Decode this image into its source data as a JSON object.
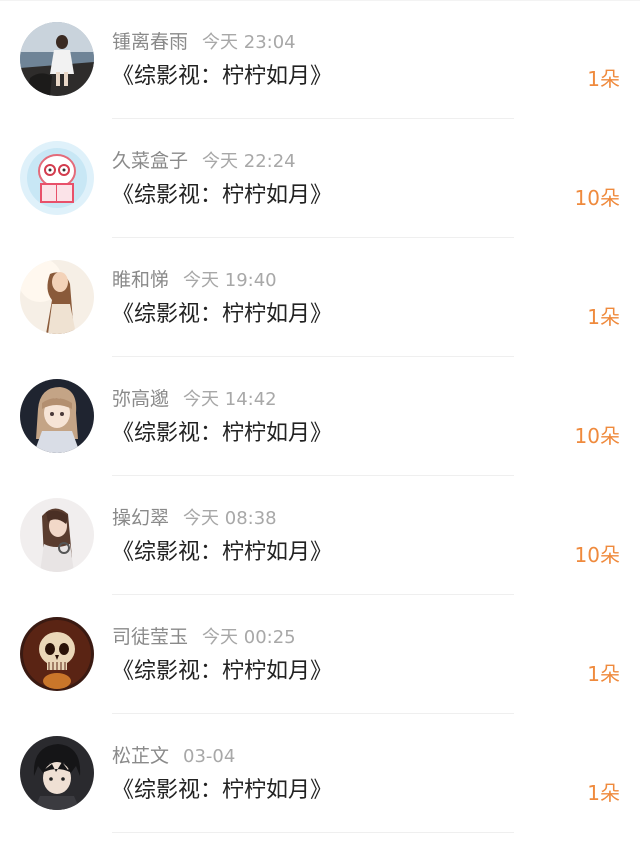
{
  "colors": {
    "amount": "#ef8a3d",
    "name": "#8a8a8a",
    "time": "#a8a8a8",
    "title": "#222222"
  },
  "list": {
    "items": [
      {
        "name": "锺离春雨",
        "time": "今天 23:04",
        "title": "《综影视：柠柠如月》",
        "amount": "1朵",
        "avatar": "girl-by-sea-avatar"
      },
      {
        "name": "久菜盒子",
        "time": "今天 22:24",
        "title": "《综影视：柠柠如月》",
        "amount": "10朵",
        "avatar": "cartoon-reading-avatar"
      },
      {
        "name": "睢和悌",
        "time": "今天 19:40",
        "title": "《综影视：柠柠如月》",
        "amount": "1朵",
        "avatar": "girl-silhouette-avatar"
      },
      {
        "name": "弥高邈",
        "time": "今天 14:42",
        "title": "《综影视：柠柠如月》",
        "amount": "10朵",
        "avatar": "anime-girl-avatar"
      },
      {
        "name": "操幻翠",
        "time": "今天 08:38",
        "title": "《综影视：柠柠如月》",
        "amount": "10朵",
        "avatar": "girl-headphones-avatar"
      },
      {
        "name": "司徒莹玉",
        "time": "今天 00:25",
        "title": "《综影视：柠柠如月》",
        "amount": "1朵",
        "avatar": "skull-avatar"
      },
      {
        "name": "松芷文",
        "time": "03-04",
        "title": "《综影视：柠柠如月》",
        "amount": "1朵",
        "avatar": "anime-boy-avatar"
      }
    ]
  }
}
